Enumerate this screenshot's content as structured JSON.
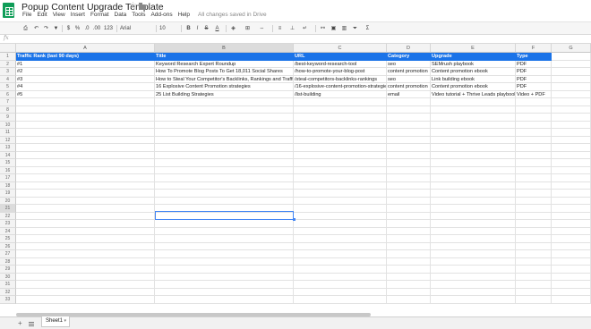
{
  "header": {
    "title": "Popup Content Upgrade Template",
    "menu": [
      "File",
      "Edit",
      "View",
      "Insert",
      "Format",
      "Data",
      "Tools",
      "Add-ons",
      "Help"
    ],
    "save_status": "All changes saved in Drive"
  },
  "toolbar": {
    "zoom_format": "123",
    "font": "Arial",
    "font_size": "10",
    "bold": "B",
    "italic": "I",
    "strike": "S",
    "text_color": "A",
    "percent": "%",
    "currency": "$",
    "decimal": ".0",
    "decimal_more": ".00",
    "sum": "Σ"
  },
  "formula_bar": {
    "fx": "fx"
  },
  "columns": [
    "A",
    "B",
    "C",
    "D",
    "E",
    "F",
    "G"
  ],
  "rows": [
    "1",
    "2",
    "3",
    "4",
    "5",
    "6",
    "7",
    "8",
    "9",
    "10",
    "11",
    "12",
    "13",
    "14",
    "15",
    "16",
    "17",
    "18",
    "19",
    "20",
    "21",
    "22",
    "23",
    "24",
    "25",
    "26",
    "27",
    "28",
    "29",
    "30",
    "31",
    "32",
    "33"
  ],
  "table": {
    "headers": [
      "Traffic Rank (last 90 days)",
      "Title",
      "URL",
      "Category",
      "Upgrade",
      "Type"
    ],
    "rows": [
      [
        "#1",
        "Keyword Research Expert Roundup",
        "/best-keyword-research-tool",
        "seo",
        "SEMrush playbook",
        "PDF"
      ],
      [
        "#2",
        "How To Promote Blog Posts To Get 18,011 Social Shares",
        "/how-to-promote-your-blog-post",
        "content promotion",
        "Content promotion ebook",
        "PDF"
      ],
      [
        "#3",
        "How to Steal Your Competitor's Backlinks, Rankings and Traffic",
        "/steal-competitors-backlinks-rankings",
        "seo",
        "Link building ebook",
        "PDF"
      ],
      [
        "#4",
        "16 Explosive Content Promotion strategies",
        "/16-explosive-content-promotion-strategies",
        "content promotion",
        "Content promotion ebook",
        "PDF"
      ],
      [
        "#5",
        "25 List Building Strategies",
        "/list-building",
        "email",
        "Video tutorial + Thrive Leads playbook",
        "Video + PDF"
      ]
    ]
  },
  "sheets": {
    "add": "+",
    "active": "Sheet1"
  },
  "colors": {
    "header_fill": "#1a73e8",
    "selection": "#4285f4",
    "logo": "#0f9d58"
  }
}
